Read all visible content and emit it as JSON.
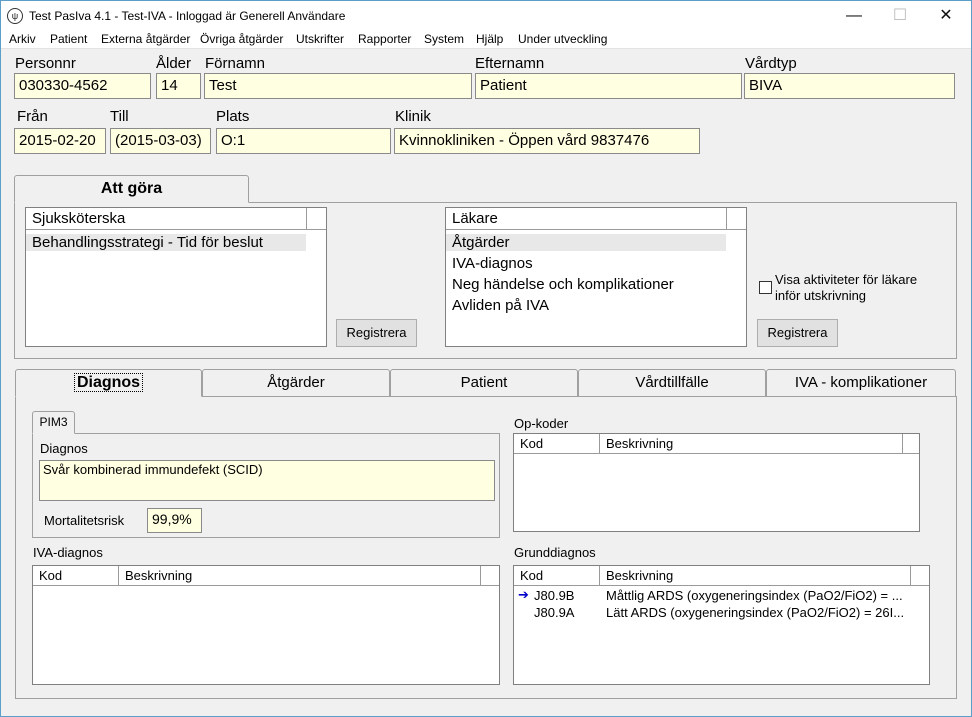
{
  "window": {
    "title": "Test PasIva  4.1  -  Test-IVA  -  Inloggad är Generell Användare",
    "icon": "app-logo-icon",
    "controls": {
      "minimize": "—",
      "maximize": "☐",
      "close": "✕"
    }
  },
  "menu": [
    "Arkiv",
    "Patient",
    "Externa åtgärder",
    "Övriga åtgärder",
    "Utskrifter",
    "Rapporter",
    "System",
    "Hjälp",
    "Under utveckling"
  ],
  "patient": {
    "personnr_label": "Personnr",
    "personnr": "030330-4562",
    "alder_label": "Ålder",
    "alder": "14",
    "fornamn_label": "Förnamn",
    "fornamn": "Test",
    "efternamn_label": "Efternamn",
    "efternamn": "Patient",
    "vardtyp_label": "Vårdtyp",
    "vardtyp": "BIVA",
    "fran_label": "Från",
    "fran": "2015-02-20",
    "till_label": "Till",
    "till": "(2015-03-03)",
    "plats_label": "Plats",
    "plats": "O:1",
    "klinik_label": "Klinik",
    "klinik": "Kvinnokliniken - Öppen vård 9837476"
  },
  "todo": {
    "tab_label": "Att göra",
    "nurse": {
      "header": "Sjuksköterska",
      "items": [
        "Behandlingsstrategi - Tid för beslut"
      ],
      "register": "Registrera"
    },
    "doctor": {
      "header": "Läkare",
      "items": [
        "Åtgärder",
        "IVA-diagnos",
        "Neg händelse och komplikationer",
        "Avliden på IVA"
      ],
      "register": "Registrera"
    },
    "checkbox_label_1": "Visa aktiviteter för läkare",
    "checkbox_label_2": "inför utskrivning",
    "checkbox_checked": false
  },
  "tabs": [
    "Diagnos",
    "Åtgärder",
    "Patient",
    "Vårdtillfälle",
    "IVA - komplikationer"
  ],
  "diagnos": {
    "subtab": "PIM3",
    "diagnos_label": "Diagnos",
    "diagnos_value": "Svår kombinerad immundefekt (SCID)",
    "mort_label": "Mortalitetsrisk",
    "mort_value": "99,9%",
    "opkoder": {
      "label": "Op-koder",
      "col_kod": "Kod",
      "col_besk": "Beskrivning"
    },
    "ivadiagnos": {
      "label": "IVA-diagnos",
      "col_kod": "Kod",
      "col_besk": "Beskrivning"
    },
    "grunddiagnos": {
      "label": "Grunddiagnos",
      "col_kod": "Kod",
      "col_besk": "Beskrivning",
      "rows": [
        {
          "kod": "J80.9B",
          "besk": "Måttlig ARDS (oxygeneringsindex (PaO2/FiO2) = ..."
        },
        {
          "kod": "J80.9A",
          "besk": "Lätt ARDS (oxygeneringsindex (PaO2/FiO2) = 26I..."
        }
      ]
    }
  }
}
